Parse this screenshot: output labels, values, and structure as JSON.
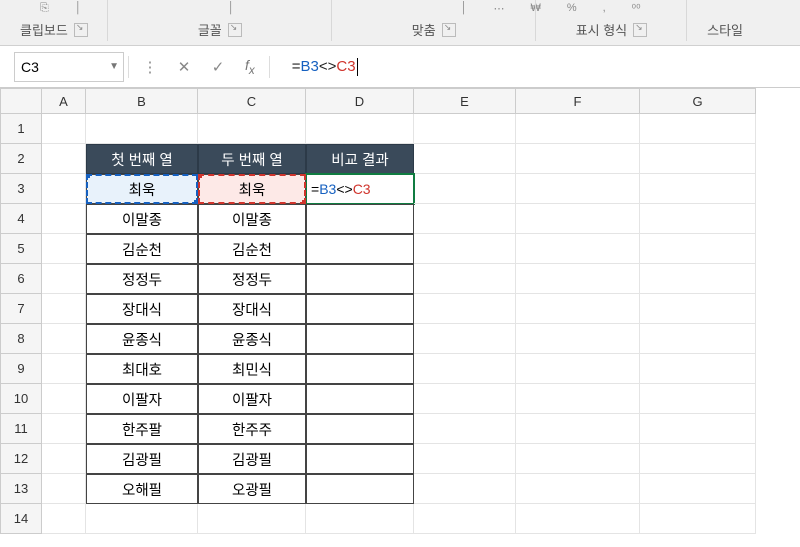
{
  "ribbon": {
    "groups": {
      "clipboard": "클립보드",
      "font": "글꼴",
      "alignment": "맞춤",
      "number": "표시 형식",
      "styles": "스타일"
    }
  },
  "namebox": {
    "value": "C3"
  },
  "formula": {
    "ref_b": "B3",
    "op1": "<",
    "space": " ",
    "op2": ">",
    "ref_c": "C3"
  },
  "columns": [
    "A",
    "B",
    "C",
    "D",
    "E",
    "F",
    "G"
  ],
  "rows": [
    "1",
    "2",
    "3",
    "4",
    "5",
    "6",
    "7",
    "8",
    "9",
    "10",
    "11",
    "12",
    "13",
    "14"
  ],
  "table": {
    "headers": {
      "b": "첫 번째 열",
      "c": "두 번째 열",
      "d": "비교 결과"
    },
    "data": [
      {
        "b": "최욱",
        "c": "최욱",
        "d_formula": "=B3<>C3"
      },
      {
        "b": "이말종",
        "c": "이말종",
        "d_formula": ""
      },
      {
        "b": "김순천",
        "c": "김순천",
        "d_formula": ""
      },
      {
        "b": "정정두",
        "c": "정정두",
        "d_formula": ""
      },
      {
        "b": "장대식",
        "c": "장대식",
        "d_formula": ""
      },
      {
        "b": "윤종식",
        "c": "윤종식",
        "d_formula": ""
      },
      {
        "b": "최대호",
        "c": "최민식",
        "d_formula": ""
      },
      {
        "b": "이팔자",
        "c": "이팔자",
        "d_formula": ""
      },
      {
        "b": "한주팔",
        "c": "한주주",
        "d_formula": ""
      },
      {
        "b": "김광필",
        "c": "김광필",
        "d_formula": ""
      },
      {
        "b": "오해필",
        "c": "오광필",
        "d_formula": ""
      }
    ]
  }
}
